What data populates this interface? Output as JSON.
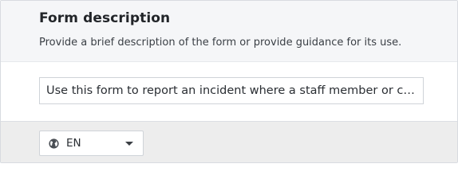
{
  "section": {
    "title": "Form description",
    "subtitle": "Provide a brief description of the form or provide guidance for its use."
  },
  "description_field": {
    "value": "Use this form to report an incident where a staff member or client was injured."
  },
  "language_select": {
    "selected": "EN",
    "icon": "globe-icon",
    "caret_icon": "chevron-down-icon"
  }
}
